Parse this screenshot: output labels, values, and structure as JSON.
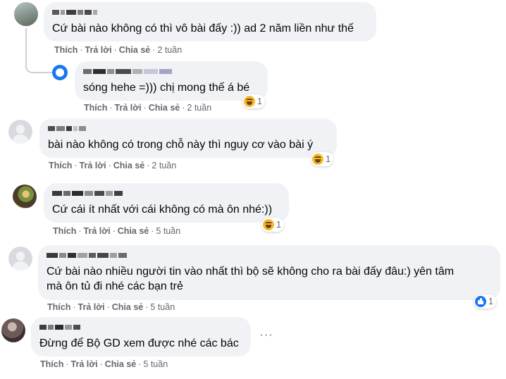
{
  "actions": {
    "like": "Thích",
    "reply": "Trả lời",
    "share": "Chia sẻ",
    "separator": "·"
  },
  "colors": {
    "bubble": "#f0f2f5",
    "meta": "#65676b",
    "text": "#050505",
    "thread_line": "#ced0d4",
    "haha": "#f7b928",
    "like": "#1877f2"
  },
  "comments": [
    {
      "avatar": "photo-avatar",
      "text": "Cứ bài nào không có thì vô bài đấy :)) ad 2 năm liền như thế",
      "time": "2 tuần"
    },
    {
      "avatar": "reply-avatar",
      "text": "sóng hehe =))) chị mong thế á bé",
      "time": "2 tuần",
      "reaction": {
        "icon": "haha-icon",
        "count": "1"
      }
    },
    {
      "avatar": "default-avatar",
      "text": "bài nào không có trong chỗ này thì nguy cơ vào bài ý",
      "time": "2 tuần",
      "reaction": {
        "icon": "haha-icon",
        "count": "1"
      }
    },
    {
      "avatar": "photo-avatar",
      "text": "Cứ cái ít nhất với cái không có mà ôn nhé:))",
      "time": "5 tuần",
      "reaction": {
        "icon": "haha-icon",
        "count": "1"
      }
    },
    {
      "avatar": "default-avatar",
      "lines": [
        "Cứ bài nào nhiều người tin vào nhất thì bộ sẽ không cho ra bài đấy đâu:) yên tâm",
        "mà ôn tủ đi nhé các bạn trẻ"
      ],
      "time": "5 tuần",
      "reaction": {
        "icon": "like-icon",
        "count": "1"
      }
    },
    {
      "avatar": "photo-avatar",
      "text": "Đừng để Bộ GD xem được nhé các bác",
      "time": "5 tuần",
      "more": "···"
    }
  ]
}
